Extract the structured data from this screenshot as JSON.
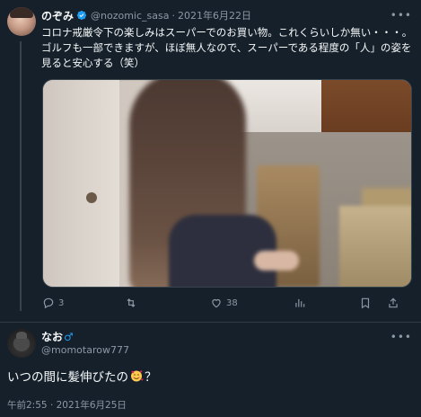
{
  "tweet": {
    "name": "のぞみ",
    "handle": "@nozomic_sasa",
    "separator": "·",
    "date": "2021年6月22日",
    "text": "コロナ戒厳令下の楽しみはスーパーでのお買い物。これくらいしか無い・・・。ゴルフも一部できますが、ほぼ無人なので、スーパーである程度の「人」の姿を見ると安心する（笑）",
    "more_icon": "more-dots-icon",
    "media_description_icon": "photo",
    "actions": {
      "reply_count": "3",
      "retweet_count": "",
      "like_count": "38",
      "views_count": ""
    },
    "colors": {
      "accent": "#1d9bf0",
      "muted": "#8b98a5",
      "background": "#15202b"
    }
  },
  "reply": {
    "name": "なお",
    "gender_symbol": "♂",
    "handle": "@momotarow777",
    "text": "いつの間に髪伸びたの",
    "text_suffix": "？",
    "emoji_icon": "smiling-face-with-hearts-icon",
    "time": "午前2:55",
    "separator": "·",
    "date": "2021年6月25日"
  }
}
